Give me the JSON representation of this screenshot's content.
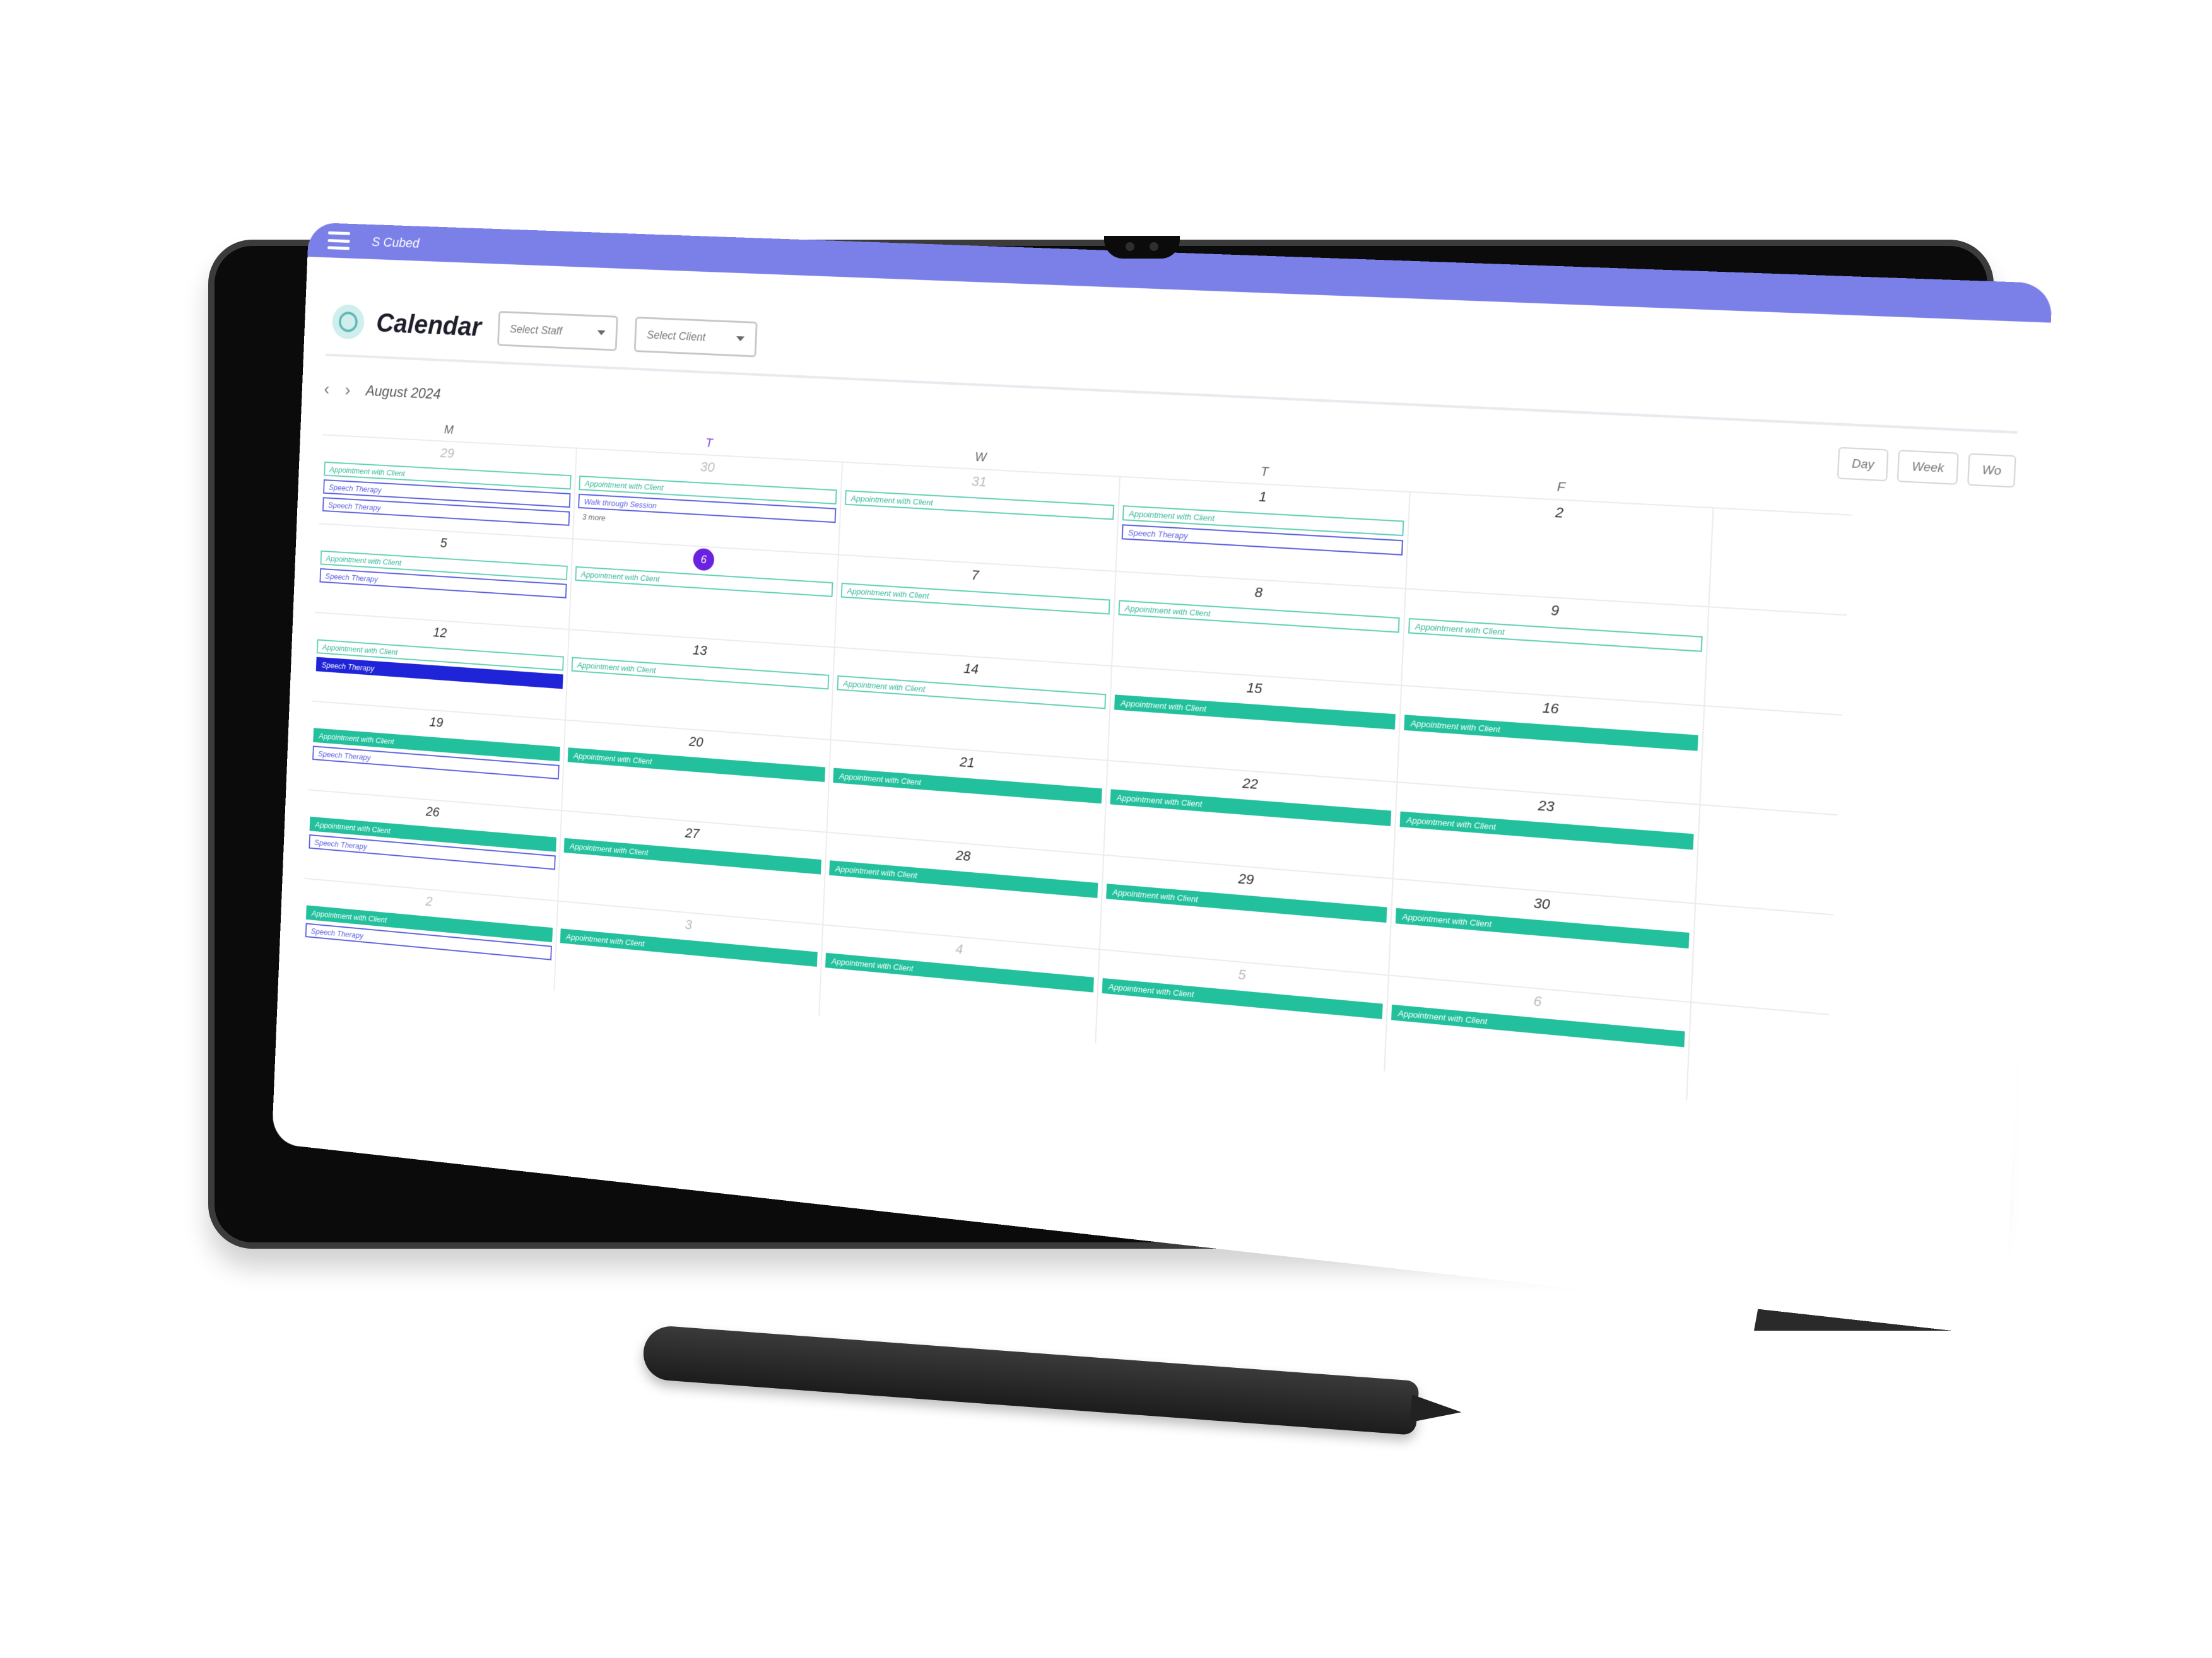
{
  "app": {
    "name": "S Cubed",
    "page_title": "Calendar"
  },
  "filters": {
    "staff_placeholder": "Select Staff",
    "client_placeholder": "Select Client"
  },
  "toolbar": {
    "prev": "‹",
    "next": "›",
    "month": "August 2024",
    "views": [
      "Day",
      "Week",
      "Wo"
    ]
  },
  "days_of_week": [
    "M",
    "T",
    "W",
    "T",
    "F"
  ],
  "today_index": 1,
  "colors": {
    "topbar": "#7b7fe8",
    "appointment": "#22c09c",
    "speech": "#5a5ee0",
    "today": "#6a22e0"
  },
  "weeks": [
    {
      "days": [
        {
          "num": "29",
          "muted": true,
          "events": [
            {
              "label": "Appointment with Client",
              "kind": "appt-outline"
            },
            {
              "label": "Speech Therapy",
              "kind": "speech-outline"
            },
            {
              "label": "Speech Therapy",
              "kind": "speech-outline"
            }
          ]
        },
        {
          "num": "30",
          "muted": true,
          "events": [
            {
              "label": "Appointment with Client",
              "kind": "appt-outline"
            },
            {
              "label": "Walk through Session",
              "kind": "walk"
            }
          ],
          "more": "3 more"
        },
        {
          "num": "31",
          "muted": true,
          "events": [
            {
              "label": "Appointment with Client",
              "kind": "appt-outline"
            }
          ]
        },
        {
          "num": "1",
          "muted": false,
          "events": [
            {
              "label": "Appointment with Client",
              "kind": "appt-outline"
            },
            {
              "label": "Speech Therapy",
              "kind": "speech-outline"
            }
          ]
        },
        {
          "num": "2",
          "muted": false,
          "events": []
        }
      ]
    },
    {
      "days": [
        {
          "num": "5",
          "muted": false,
          "events": [
            {
              "label": "Appointment with Client",
              "kind": "appt-outline"
            },
            {
              "label": "Speech Therapy",
              "kind": "speech-outline"
            }
          ]
        },
        {
          "num": "6",
          "muted": false,
          "today": true,
          "events": [
            {
              "label": "Appointment with Client",
              "kind": "appt-outline"
            }
          ]
        },
        {
          "num": "7",
          "muted": false,
          "events": [
            {
              "label": "Appointment with Client",
              "kind": "appt-outline"
            }
          ]
        },
        {
          "num": "8",
          "muted": false,
          "events": [
            {
              "label": "Appointment with Client",
              "kind": "appt-outline"
            }
          ]
        },
        {
          "num": "9",
          "muted": false,
          "events": [
            {
              "label": "Appointment with Client",
              "kind": "appt-outline"
            }
          ]
        }
      ]
    },
    {
      "days": [
        {
          "num": "12",
          "muted": false,
          "events": [
            {
              "label": "Appointment with Client",
              "kind": "appt-outline"
            },
            {
              "label": "Speech Therapy",
              "kind": "speech-solid"
            }
          ]
        },
        {
          "num": "13",
          "muted": false,
          "events": [
            {
              "label": "Appointment with Client",
              "kind": "appt-outline"
            }
          ]
        },
        {
          "num": "14",
          "muted": false,
          "events": [
            {
              "label": "Appointment with Client",
              "kind": "appt-outline"
            }
          ]
        },
        {
          "num": "15",
          "muted": false,
          "events": [
            {
              "label": "Appointment with Client",
              "kind": "appt-solid"
            }
          ]
        },
        {
          "num": "16",
          "muted": false,
          "events": [
            {
              "label": "Appointment with Client",
              "kind": "appt-solid"
            }
          ]
        }
      ]
    },
    {
      "days": [
        {
          "num": "19",
          "muted": false,
          "events": [
            {
              "label": "Appointment with Client",
              "kind": "appt-solid"
            },
            {
              "label": "Speech Therapy",
              "kind": "speech-outline"
            }
          ]
        },
        {
          "num": "20",
          "muted": false,
          "events": [
            {
              "label": "Appointment with Client",
              "kind": "appt-solid"
            }
          ]
        },
        {
          "num": "21",
          "muted": false,
          "events": [
            {
              "label": "Appointment with Client",
              "kind": "appt-solid"
            }
          ]
        },
        {
          "num": "22",
          "muted": false,
          "events": [
            {
              "label": "Appointment with Client",
              "kind": "appt-solid"
            }
          ]
        },
        {
          "num": "23",
          "muted": false,
          "events": [
            {
              "label": "Appointment with Client",
              "kind": "appt-solid"
            }
          ]
        }
      ]
    },
    {
      "days": [
        {
          "num": "26",
          "muted": false,
          "events": [
            {
              "label": "Appointment with Client",
              "kind": "appt-solid"
            },
            {
              "label": "Speech Therapy",
              "kind": "speech-outline"
            }
          ]
        },
        {
          "num": "27",
          "muted": false,
          "events": [
            {
              "label": "Appointment with Client",
              "kind": "appt-solid"
            }
          ]
        },
        {
          "num": "28",
          "muted": false,
          "events": [
            {
              "label": "Appointment with Client",
              "kind": "appt-solid"
            }
          ]
        },
        {
          "num": "29",
          "muted": false,
          "events": [
            {
              "label": "Appointment with Client",
              "kind": "appt-solid"
            }
          ]
        },
        {
          "num": "30",
          "muted": false,
          "events": [
            {
              "label": "Appointment with Client",
              "kind": "appt-solid"
            }
          ]
        }
      ]
    },
    {
      "days": [
        {
          "num": "2",
          "muted": true,
          "events": [
            {
              "label": "Appointment with Client",
              "kind": "appt-solid"
            },
            {
              "label": "Speech Therapy",
              "kind": "speech-outline"
            }
          ]
        },
        {
          "num": "3",
          "muted": true,
          "events": [
            {
              "label": "Appointment with Client",
              "kind": "appt-solid"
            }
          ]
        },
        {
          "num": "4",
          "muted": true,
          "events": [
            {
              "label": "Appointment with Client",
              "kind": "appt-solid"
            }
          ]
        },
        {
          "num": "5",
          "muted": true,
          "events": [
            {
              "label": "Appointment with Client",
              "kind": "appt-solid"
            }
          ]
        },
        {
          "num": "6",
          "muted": true,
          "events": [
            {
              "label": "Appointment with Client",
              "kind": "appt-solid"
            }
          ]
        }
      ]
    }
  ]
}
